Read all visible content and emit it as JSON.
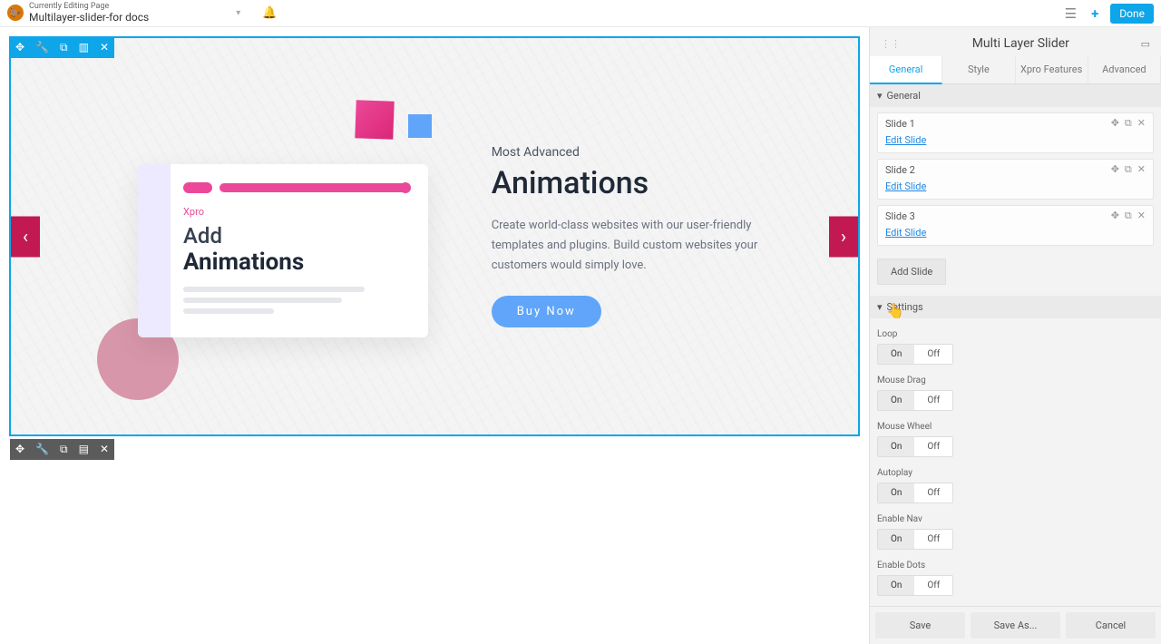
{
  "topbar": {
    "edit_label": "Currently Editing Page",
    "page_name": "Multilayer-slider-for docs",
    "done": "Done"
  },
  "preview": {
    "tagline": "Most Advanced",
    "headline": "Animations",
    "description": "Create world-class websites with our user-friendly templates and plugins. Build custom websites your customers would simply love.",
    "cta": "Buy Now",
    "card_label": "Xpro",
    "card_title_1": "Add",
    "card_title_2": "Animations"
  },
  "sidebar": {
    "title": "Multi Layer Slider",
    "tabs": {
      "general": "General",
      "style": "Style",
      "xpro": "Xpro Features",
      "advanced": "Advanced"
    },
    "sections": {
      "general": "General",
      "settings": "Settings"
    },
    "slides": [
      {
        "name": "Slide 1",
        "edit": "Edit Slide"
      },
      {
        "name": "Slide 2",
        "edit": "Edit Slide"
      },
      {
        "name": "Slide 3",
        "edit": "Edit Slide"
      }
    ],
    "add_slide": "Add Slide",
    "settings_items": {
      "loop": {
        "label": "Loop",
        "on": "On",
        "off": "Off",
        "value": "on"
      },
      "mouse_drag": {
        "label": "Mouse Drag",
        "on": "On",
        "off": "Off",
        "value": "on"
      },
      "mouse_wheel": {
        "label": "Mouse Wheel",
        "on": "On",
        "off": "Off",
        "value": "on"
      },
      "autoplay": {
        "label": "Autoplay",
        "on": "On",
        "off": "Off",
        "value": "on"
      },
      "enable_nav": {
        "label": "Enable Nav",
        "on": "On",
        "off": "Off",
        "value": "on"
      },
      "enable_dots": {
        "label": "Enable Dots",
        "on": "On",
        "off": "Off",
        "value": "on"
      }
    },
    "footer": {
      "save": "Save",
      "save_as": "Save As...",
      "cancel": "Cancel"
    }
  }
}
